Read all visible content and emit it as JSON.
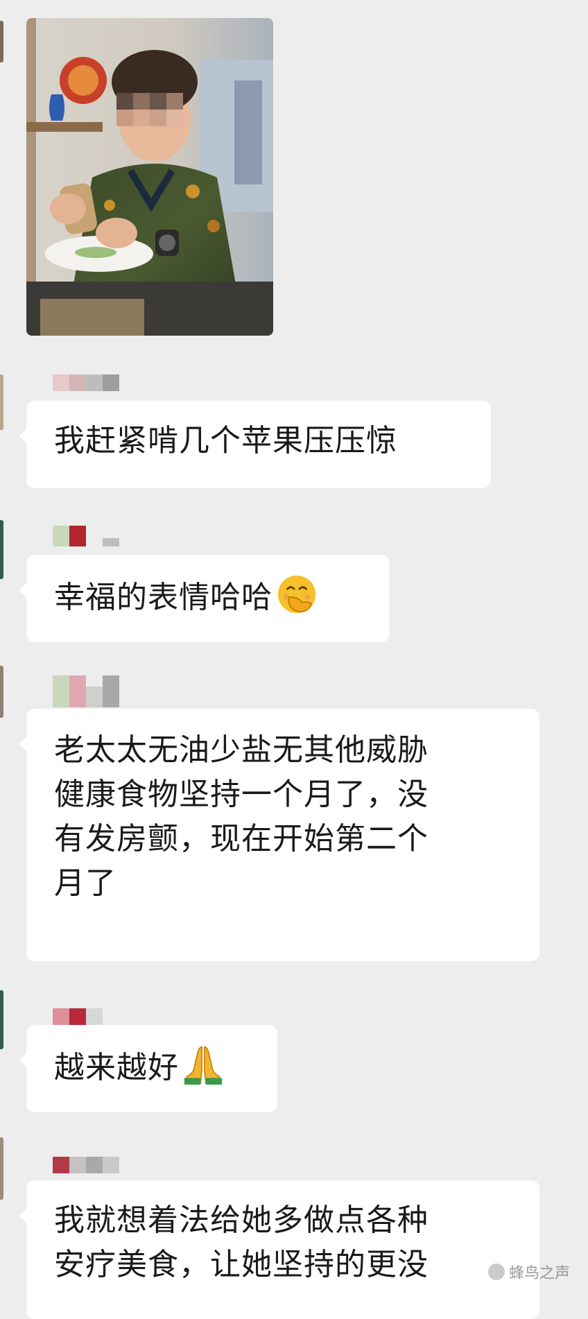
{
  "messages": [
    {
      "type": "image"
    },
    {
      "type": "text",
      "text": "我赶紧啃几个苹果压压惊"
    },
    {
      "type": "text",
      "text": "幸福的表情哈哈",
      "emoji": "smiling-face-with-hand-over-mouth"
    },
    {
      "type": "text",
      "text": "老太太无油少盐无其他威胁\n健康食物坚持一个月了，没\n有发房颤，现在开始第二个\n月了"
    },
    {
      "type": "text",
      "text": "越来越好",
      "emoji": "folded-hands"
    },
    {
      "type": "text",
      "text": "我就想着法给她多做点各种\n安疗美食，让她坚持的更没"
    }
  ],
  "watermark": {
    "text": "蜂鸟之声"
  },
  "colors": {
    "background": "#ededed",
    "bubble": "#ffffff",
    "text": "#1a1a1a"
  }
}
